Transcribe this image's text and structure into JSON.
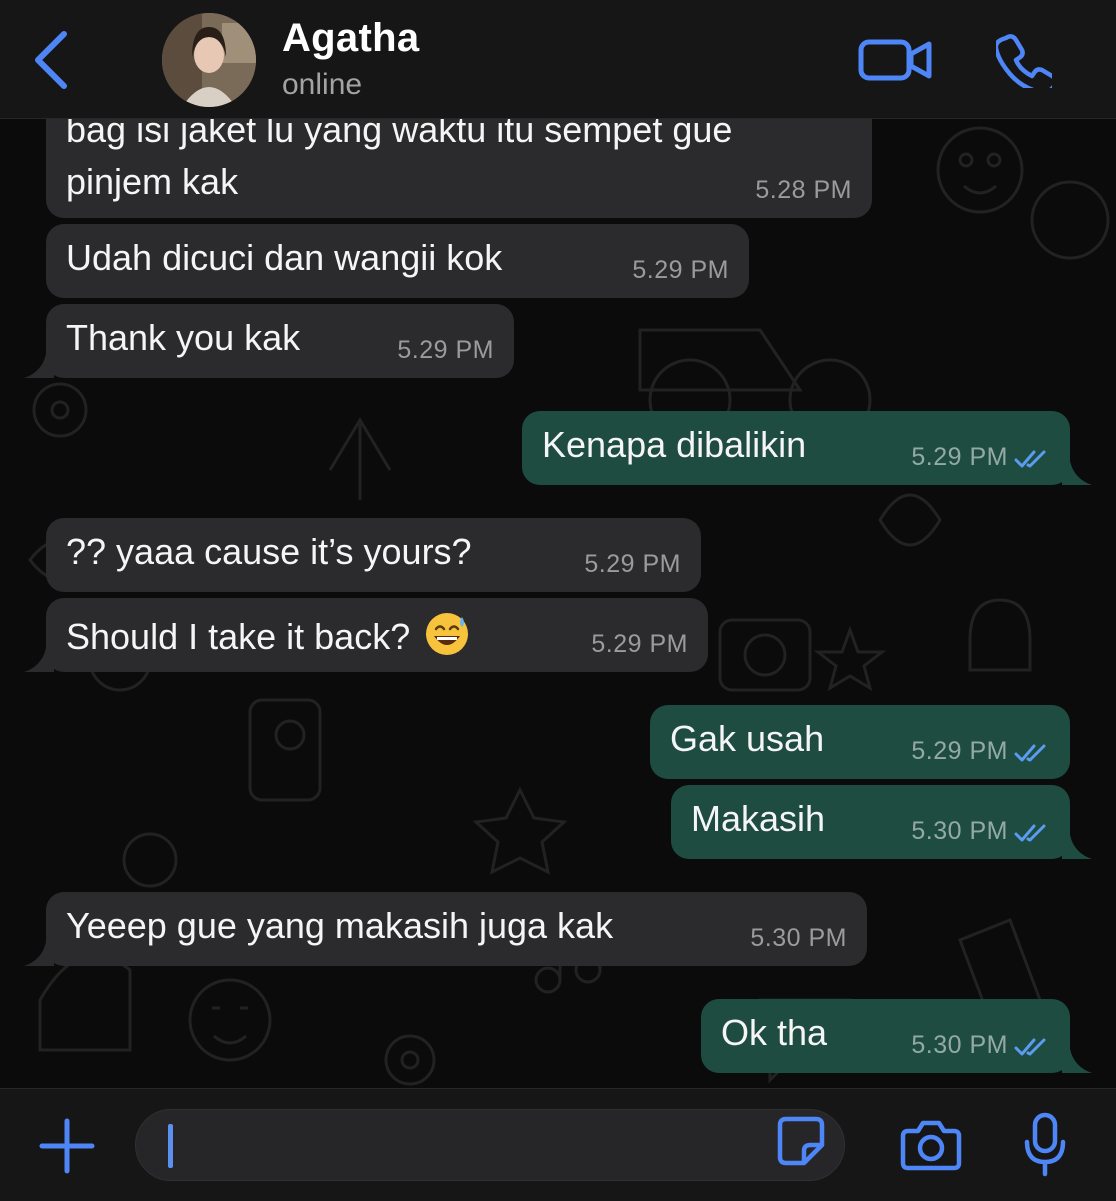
{
  "header": {
    "contact_name": "Agatha",
    "status": "online",
    "accent_color": "#4f86f7"
  },
  "icons": {
    "back": "chevron-left-icon",
    "video": "video-camera-icon",
    "call": "phone-icon",
    "attach": "plus-icon",
    "sticker": "sticker-icon",
    "camera": "camera-icon",
    "mic": "microphone-icon",
    "read_receipt": "double-check-icon"
  },
  "messages": [
    {
      "direction": "in",
      "text_line1": "bag isi jaket lu yang waktu itu sempet gue",
      "text_line2": "pinjem kak",
      "time": "5.28 PM"
    },
    {
      "direction": "in",
      "text": "Udah dicuci dan wangii kok",
      "time": "5.29 PM"
    },
    {
      "direction": "in",
      "text": "Thank you kak",
      "time": "5.29 PM"
    },
    {
      "direction": "out",
      "text": "Kenapa dibalikin",
      "time": "5.29 PM",
      "status": "read"
    },
    {
      "direction": "in",
      "text": "?? yaaa cause it’s yours?",
      "time": "5.29 PM"
    },
    {
      "direction": "in",
      "text": "Should I take it back?",
      "emoji": "grinning-face-with-sweat",
      "time": "5.29 PM"
    },
    {
      "direction": "out",
      "text": "Gak usah",
      "time": "5.29 PM",
      "status": "read"
    },
    {
      "direction": "out",
      "text": "Makasih",
      "time": "5.30 PM",
      "status": "read"
    },
    {
      "direction": "in",
      "text": "Yeeep gue yang makasih juga kak",
      "time": "5.30 PM"
    },
    {
      "direction": "out",
      "text": "Ok tha",
      "time": "5.30 PM",
      "status": "read"
    }
  ],
  "colors": {
    "incoming_bubble": "#2b2b2d",
    "outgoing_bubble": "#1e4c41",
    "read_tick": "#5b9bf0",
    "background": "#0b0b0b"
  },
  "composer": {
    "value": ""
  }
}
